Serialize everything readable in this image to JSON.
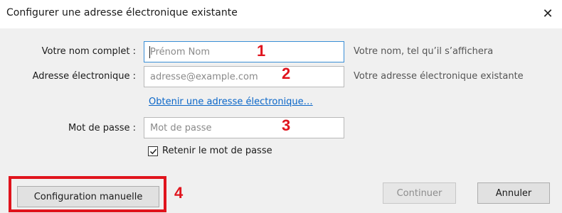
{
  "dialog": {
    "title": "Configurer une adresse électronique existante",
    "close_glyph": "✕"
  },
  "form": {
    "name": {
      "label": "Votre nom complet :",
      "placeholder": "Prénom Nom",
      "hint": "Votre nom, tel qu’il s’affichera",
      "step": "1"
    },
    "email": {
      "label": "Adresse électronique :",
      "placeholder": "adresse@example.com",
      "hint": "Votre adresse électronique existante",
      "step": "2"
    },
    "get_address_link": "Obtenir une adresse électronique…",
    "password": {
      "label": "Mot de passe :",
      "placeholder": "Mot de passe",
      "step": "3"
    },
    "remember": {
      "label": "Retenir le mot de passe",
      "checked": true
    }
  },
  "buttons": {
    "manual": "Configuration manuelle",
    "manual_step": "4",
    "continue": "Continuer",
    "cancel": "Annuler"
  },
  "colors": {
    "annotation": "#e0141d",
    "link": "#0a66c8",
    "focus_border": "#3a8ed6"
  },
  "icons": {
    "close": "close-icon",
    "check": "checkmark-icon"
  }
}
